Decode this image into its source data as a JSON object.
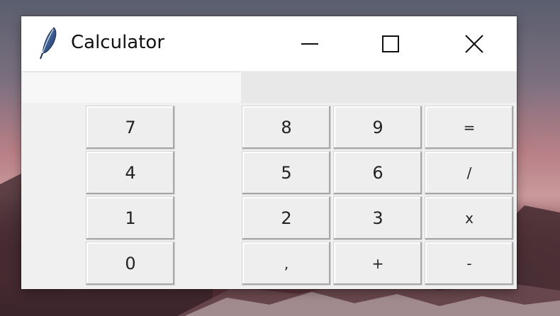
{
  "window": {
    "title": "Calculator",
    "app_icon": "feather-icon",
    "controls": {
      "minimize_icon": "minimize-icon",
      "maximize_icon": "maximize-icon",
      "close_icon": "close-icon"
    }
  },
  "display": {
    "value": ""
  },
  "keys": {
    "k7": "7",
    "k8": "8",
    "k9": "9",
    "eq": "=",
    "k4": "4",
    "k5": "5",
    "k6": "6",
    "div": "/",
    "k1": "1",
    "k2": "2",
    "k3": "3",
    "mul": "x",
    "k0": "0",
    "comma": ",",
    "add": "+",
    "sub": "-"
  },
  "colors": {
    "button_face": "#eeeeee",
    "window_bg": "#f0f0f0",
    "titlebar_bg": "#ffffff"
  }
}
